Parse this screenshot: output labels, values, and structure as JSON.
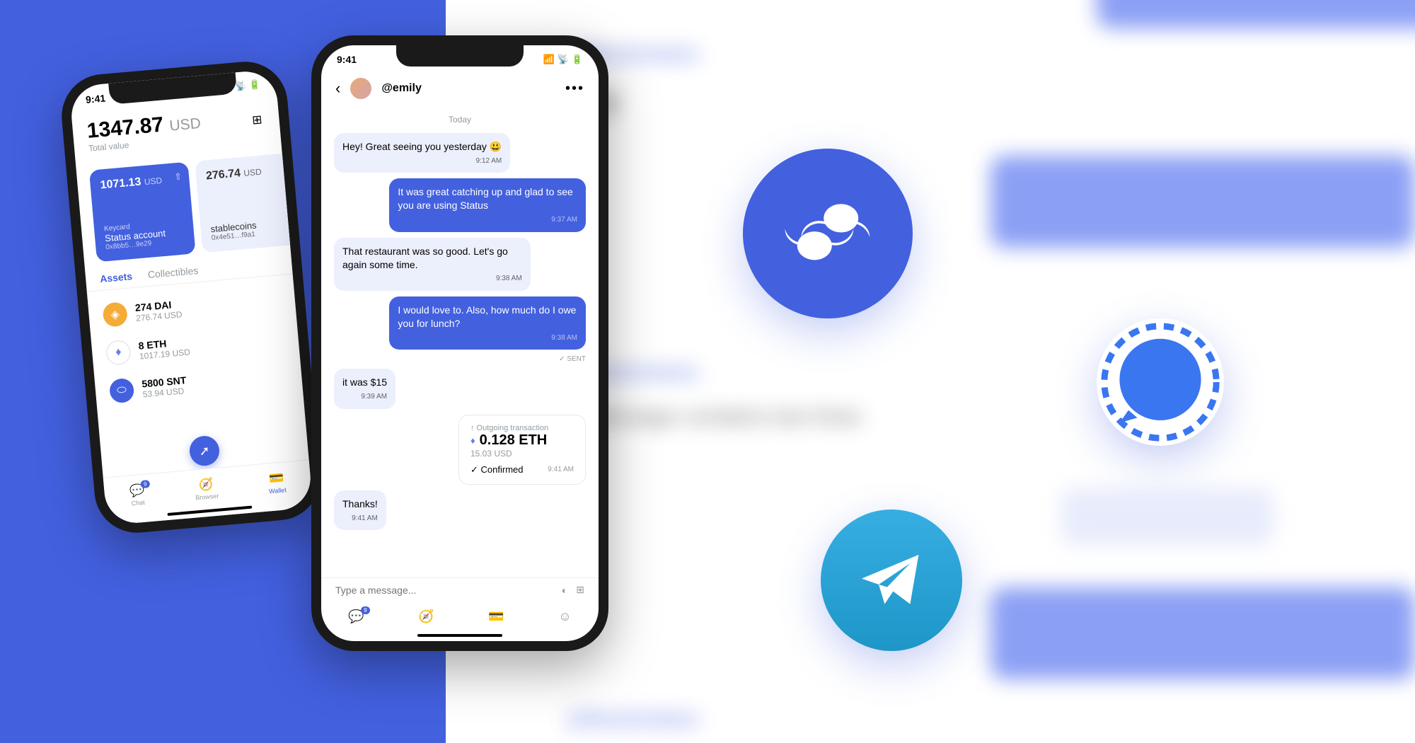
{
  "status_bar": {
    "time": "9:41"
  },
  "wallet": {
    "total_value": "1347.87",
    "total_currency": "USD",
    "total_label": "Total value",
    "accounts": [
      {
        "amount": "1071.13",
        "currency": "USD",
        "keycard": "Keycard",
        "name": "Status account",
        "address": "0x8bb5…9e29"
      },
      {
        "amount": "276.74",
        "currency": "USD",
        "name": "stablecoins",
        "address": "0x4e51…f9a1"
      }
    ],
    "tabs": {
      "assets": "Assets",
      "collectibles": "Collectibles"
    },
    "assets": [
      {
        "amount": "274 DAI",
        "usd": "276.74 USD"
      },
      {
        "amount": "8 ETH",
        "usd": "1017.19 USD"
      },
      {
        "amount": "5800 SNT",
        "usd": "53.94 USD"
      }
    ],
    "nav": {
      "chat": "Chat",
      "browser": "Browser",
      "wallet": "Wallet",
      "chat_badge": "9"
    }
  },
  "chat": {
    "username": "@emily",
    "day": "Today",
    "messages": {
      "m1": {
        "text": "Hey! Great seeing you yesterday 😃",
        "time": "9:12 AM"
      },
      "m2": {
        "text": "It was great catching up and glad to see you are using Status",
        "time": "9:37 AM"
      },
      "m3": {
        "text": "That restaurant was so good. Let's go again some time.",
        "time": "9:38 AM"
      },
      "m4": {
        "text": "I would love to. Also, how much do I owe you for lunch?",
        "time": "9:38 AM"
      },
      "sent": "✓ SENT",
      "m5": {
        "text": "it was $15",
        "time": "9:39 AM"
      },
      "m6": {
        "text": "Thanks!",
        "time": "9:41 AM"
      }
    },
    "transaction": {
      "label": "↑ Outgoing transaction",
      "amount": "0.128 ETH",
      "usd": "15.03 USD",
      "status": "Confirmed",
      "time": "9:41 AM"
    },
    "input_placeholder": "Type a message...",
    "nav_badge": "9"
  },
  "bg": {
    "handle": "@blockchainz",
    "two_line": "a message contains two lines",
    "hey": "Hey"
  }
}
